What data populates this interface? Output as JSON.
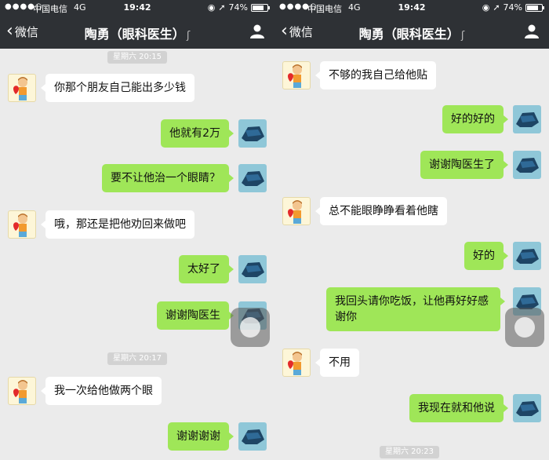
{
  "left": {
    "status": {
      "signal": "●●●●○",
      "carrier": "中国电信",
      "network": "4G",
      "time": "19:42",
      "battery": "74%"
    },
    "nav": {
      "back_label": "微信",
      "title": "陶勇（眼科医生）",
      "ear_icon": "ear-icon",
      "profile_icon": "person-icon"
    },
    "timestamps": [
      "星期六 20:15",
      "星期六 20:17"
    ],
    "messages": [
      {
        "from": "them",
        "text": "你那个朋友自己能出多少钱"
      },
      {
        "from": "me",
        "text": "他就有2万"
      },
      {
        "from": "me",
        "text": "要不让他治一个眼睛？"
      },
      {
        "from": "them",
        "text": "哦，那还是把他劝回来做吧"
      },
      {
        "from": "me",
        "text": "太好了"
      },
      {
        "from": "me",
        "text": "谢谢陶医生"
      },
      {
        "from": "them",
        "text": "我一次给他做两个眼"
      },
      {
        "from": "me",
        "text": "谢谢谢谢"
      }
    ]
  },
  "right": {
    "status": {
      "signal": "●●●●○",
      "carrier": "中国电信",
      "network": "4G",
      "time": "19:42",
      "battery": "74%"
    },
    "nav": {
      "back_label": "微信",
      "title": "陶勇（眼科医生）",
      "ear_icon": "ear-icon",
      "profile_icon": "person-icon"
    },
    "timestamps": [
      "星期六 20:23"
    ],
    "messages": [
      {
        "from": "them",
        "text": "不够的我自己给他贴"
      },
      {
        "from": "me",
        "text": "好的好的"
      },
      {
        "from": "me",
        "text": "谢谢陶医生了"
      },
      {
        "from": "them",
        "text": "总不能眼睁睁看着他瞎"
      },
      {
        "from": "me",
        "text": "好的"
      },
      {
        "from": "me",
        "text": "我回头请你吃饭，让他再好好感谢你"
      },
      {
        "from": "them",
        "text": "不用"
      },
      {
        "from": "me",
        "text": "我现在就和他说"
      }
    ]
  }
}
